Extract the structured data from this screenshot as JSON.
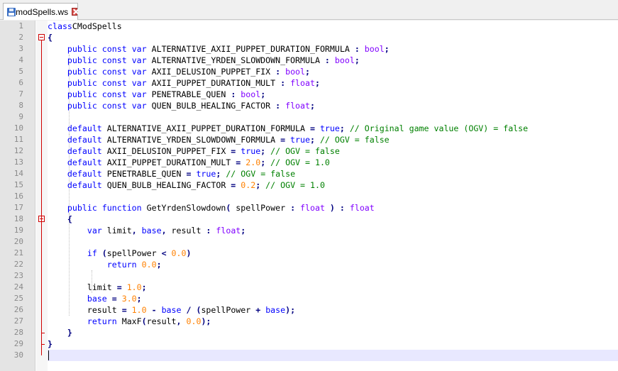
{
  "tab": {
    "filename": "modSpells.ws",
    "icon": "floppy-disk-icon",
    "close_icon": "close-icon"
  },
  "lines": [
    {
      "n": "1",
      "t": [
        [
          "kw",
          "class"
        ],
        [
          "",
          "CModSpells"
        ]
      ]
    },
    {
      "n": "2",
      "t": [
        [
          "bl",
          "{"
        ]
      ]
    },
    {
      "n": "3",
      "t": [
        [
          "",
          "    "
        ],
        [
          "kw",
          "public"
        ],
        [
          "",
          " "
        ],
        [
          "kw",
          "const"
        ],
        [
          "",
          " "
        ],
        [
          "kw",
          "var"
        ],
        [
          "",
          " ALTERNATIVE_AXII_PUPPET_DURATION_FORMULA "
        ],
        [
          "op",
          ":"
        ],
        [
          "",
          " "
        ],
        [
          "ty",
          "bool"
        ],
        [
          "op",
          ";"
        ]
      ]
    },
    {
      "n": "4",
      "t": [
        [
          "",
          "    "
        ],
        [
          "kw",
          "public"
        ],
        [
          "",
          " "
        ],
        [
          "kw",
          "const"
        ],
        [
          "",
          " "
        ],
        [
          "kw",
          "var"
        ],
        [
          "",
          " ALTERNATIVE_YRDEN_SLOWDOWN_FORMULA "
        ],
        [
          "op",
          ":"
        ],
        [
          "",
          " "
        ],
        [
          "ty",
          "bool"
        ],
        [
          "op",
          ";"
        ]
      ]
    },
    {
      "n": "5",
      "t": [
        [
          "",
          "    "
        ],
        [
          "kw",
          "public"
        ],
        [
          "",
          " "
        ],
        [
          "kw",
          "const"
        ],
        [
          "",
          " "
        ],
        [
          "kw",
          "var"
        ],
        [
          "",
          " AXII_DELUSION_PUPPET_FIX "
        ],
        [
          "op",
          ":"
        ],
        [
          "",
          " "
        ],
        [
          "ty",
          "bool"
        ],
        [
          "op",
          ";"
        ]
      ]
    },
    {
      "n": "6",
      "t": [
        [
          "",
          "    "
        ],
        [
          "kw",
          "public"
        ],
        [
          "",
          " "
        ],
        [
          "kw",
          "const"
        ],
        [
          "",
          " "
        ],
        [
          "kw",
          "var"
        ],
        [
          "",
          " AXII_PUPPET_DURATION_MULT "
        ],
        [
          "op",
          ":"
        ],
        [
          "",
          " "
        ],
        [
          "ty",
          "float"
        ],
        [
          "op",
          ";"
        ]
      ]
    },
    {
      "n": "7",
      "t": [
        [
          "",
          "    "
        ],
        [
          "kw",
          "public"
        ],
        [
          "",
          " "
        ],
        [
          "kw",
          "const"
        ],
        [
          "",
          " "
        ],
        [
          "kw",
          "var"
        ],
        [
          "",
          " PENETRABLE_QUEN "
        ],
        [
          "op",
          ":"
        ],
        [
          "",
          " "
        ],
        [
          "ty",
          "bool"
        ],
        [
          "op",
          ";"
        ]
      ]
    },
    {
      "n": "8",
      "t": [
        [
          "",
          "    "
        ],
        [
          "kw",
          "public"
        ],
        [
          "",
          " "
        ],
        [
          "kw",
          "const"
        ],
        [
          "",
          " "
        ],
        [
          "kw",
          "var"
        ],
        [
          "",
          " QUEN_BULB_HEALING_FACTOR "
        ],
        [
          "op",
          ":"
        ],
        [
          "",
          " "
        ],
        [
          "ty",
          "float"
        ],
        [
          "op",
          ";"
        ]
      ]
    },
    {
      "n": "9",
      "t": []
    },
    {
      "n": "10",
      "t": [
        [
          "",
          "    "
        ],
        [
          "kw",
          "default"
        ],
        [
          "",
          " ALTERNATIVE_AXII_PUPPET_DURATION_FORMULA "
        ],
        [
          "op",
          "="
        ],
        [
          "",
          " "
        ],
        [
          "kw",
          "true"
        ],
        [
          "op",
          ";"
        ],
        [
          "",
          " "
        ],
        [
          "cm",
          "// Original game value (OGV) = false"
        ]
      ]
    },
    {
      "n": "11",
      "t": [
        [
          "",
          "    "
        ],
        [
          "kw",
          "default"
        ],
        [
          "",
          " ALTERNATIVE_YRDEN_SLOWDOWN_FORMULA "
        ],
        [
          "op",
          "="
        ],
        [
          "",
          " "
        ],
        [
          "kw",
          "true"
        ],
        [
          "op",
          ";"
        ],
        [
          "",
          " "
        ],
        [
          "cm",
          "// OGV = false"
        ]
      ]
    },
    {
      "n": "12",
      "t": [
        [
          "",
          "    "
        ],
        [
          "kw",
          "default"
        ],
        [
          "",
          " AXII_DELUSION_PUPPET_FIX "
        ],
        [
          "op",
          "="
        ],
        [
          "",
          " "
        ],
        [
          "kw",
          "true"
        ],
        [
          "op",
          ";"
        ],
        [
          "",
          " "
        ],
        [
          "cm",
          "// OGV = false"
        ]
      ]
    },
    {
      "n": "13",
      "t": [
        [
          "",
          "    "
        ],
        [
          "kw",
          "default"
        ],
        [
          "",
          " AXII_PUPPET_DURATION_MULT "
        ],
        [
          "op",
          "="
        ],
        [
          "",
          " "
        ],
        [
          "num",
          "2.0"
        ],
        [
          "op",
          ";"
        ],
        [
          "",
          " "
        ],
        [
          "cm",
          "// OGV = 1.0"
        ]
      ]
    },
    {
      "n": "14",
      "t": [
        [
          "",
          "    "
        ],
        [
          "kw",
          "default"
        ],
        [
          "",
          " PENETRABLE_QUEN "
        ],
        [
          "op",
          "="
        ],
        [
          "",
          " "
        ],
        [
          "kw",
          "true"
        ],
        [
          "op",
          ";"
        ],
        [
          "",
          " "
        ],
        [
          "cm",
          "// OGV = false"
        ]
      ]
    },
    {
      "n": "15",
      "t": [
        [
          "",
          "    "
        ],
        [
          "kw",
          "default"
        ],
        [
          "",
          " QUEN_BULB_HEALING_FACTOR "
        ],
        [
          "op",
          "="
        ],
        [
          "",
          " "
        ],
        [
          "num",
          "0.2"
        ],
        [
          "op",
          ";"
        ],
        [
          "",
          " "
        ],
        [
          "cm",
          "// OGV = 1.0"
        ]
      ]
    },
    {
      "n": "16",
      "t": []
    },
    {
      "n": "17",
      "t": [
        [
          "",
          "    "
        ],
        [
          "kw",
          "public"
        ],
        [
          "",
          " "
        ],
        [
          "kw",
          "function"
        ],
        [
          "",
          " GetYrdenSlowdown"
        ],
        [
          "op",
          "("
        ],
        [
          "",
          " spellPower "
        ],
        [
          "op",
          ":"
        ],
        [
          "",
          " "
        ],
        [
          "ty",
          "float"
        ],
        [
          "",
          " "
        ],
        [
          "op",
          ")"
        ],
        [
          "",
          " "
        ],
        [
          "op",
          ":"
        ],
        [
          "",
          " "
        ],
        [
          "ty",
          "float"
        ]
      ]
    },
    {
      "n": "18",
      "t": [
        [
          "",
          "    "
        ],
        [
          "bl",
          "{"
        ]
      ]
    },
    {
      "n": "19",
      "t": [
        [
          "",
          "        "
        ],
        [
          "kw",
          "var"
        ],
        [
          "",
          " limit"
        ],
        [
          "op",
          ","
        ],
        [
          "",
          " "
        ],
        [
          "kw",
          "base"
        ],
        [
          "op",
          ","
        ],
        [
          "",
          " result "
        ],
        [
          "op",
          ":"
        ],
        [
          "",
          " "
        ],
        [
          "ty",
          "float"
        ],
        [
          "op",
          ";"
        ]
      ]
    },
    {
      "n": "20",
      "t": []
    },
    {
      "n": "21",
      "t": [
        [
          "",
          "        "
        ],
        [
          "kw",
          "if"
        ],
        [
          "",
          " "
        ],
        [
          "op",
          "("
        ],
        [
          "",
          "spellPower "
        ],
        [
          "op",
          "<"
        ],
        [
          "",
          " "
        ],
        [
          "num",
          "0.0"
        ],
        [
          "op",
          ")"
        ]
      ]
    },
    {
      "n": "22",
      "t": [
        [
          "",
          "            "
        ],
        [
          "kw",
          "return"
        ],
        [
          "",
          " "
        ],
        [
          "num",
          "0.0"
        ],
        [
          "op",
          ";"
        ]
      ]
    },
    {
      "n": "23",
      "t": []
    },
    {
      "n": "24",
      "t": [
        [
          "",
          "        limit "
        ],
        [
          "op",
          "="
        ],
        [
          "",
          " "
        ],
        [
          "num",
          "1.0"
        ],
        [
          "op",
          ";"
        ]
      ]
    },
    {
      "n": "25",
      "t": [
        [
          "",
          "        "
        ],
        [
          "kw",
          "base"
        ],
        [
          "",
          " "
        ],
        [
          "op",
          "="
        ],
        [
          "",
          " "
        ],
        [
          "num",
          "3.0"
        ],
        [
          "op",
          ";"
        ]
      ]
    },
    {
      "n": "26",
      "t": [
        [
          "",
          "        result "
        ],
        [
          "op",
          "="
        ],
        [
          "",
          " "
        ],
        [
          "num",
          "1.0"
        ],
        [
          "",
          " "
        ],
        [
          "op",
          "-"
        ],
        [
          "",
          " "
        ],
        [
          "kw",
          "base"
        ],
        [
          "",
          " "
        ],
        [
          "op",
          "/"
        ],
        [
          "",
          " "
        ],
        [
          "op",
          "("
        ],
        [
          "",
          "spellPower "
        ],
        [
          "op",
          "+"
        ],
        [
          "",
          " "
        ],
        [
          "kw",
          "base"
        ],
        [
          "op",
          ");"
        ]
      ]
    },
    {
      "n": "27",
      "t": [
        [
          "",
          "        "
        ],
        [
          "kw",
          "return"
        ],
        [
          "",
          " MaxF"
        ],
        [
          "op",
          "("
        ],
        [
          "",
          "result"
        ],
        [
          "op",
          ","
        ],
        [
          "",
          " "
        ],
        [
          "num",
          "0.0"
        ],
        [
          "op",
          ");"
        ]
      ]
    },
    {
      "n": "28",
      "t": [
        [
          "",
          "    "
        ],
        [
          "bl",
          "}"
        ]
      ]
    },
    {
      "n": "29",
      "t": [
        [
          "bl",
          "}"
        ]
      ]
    },
    {
      "n": "30",
      "t": []
    }
  ]
}
